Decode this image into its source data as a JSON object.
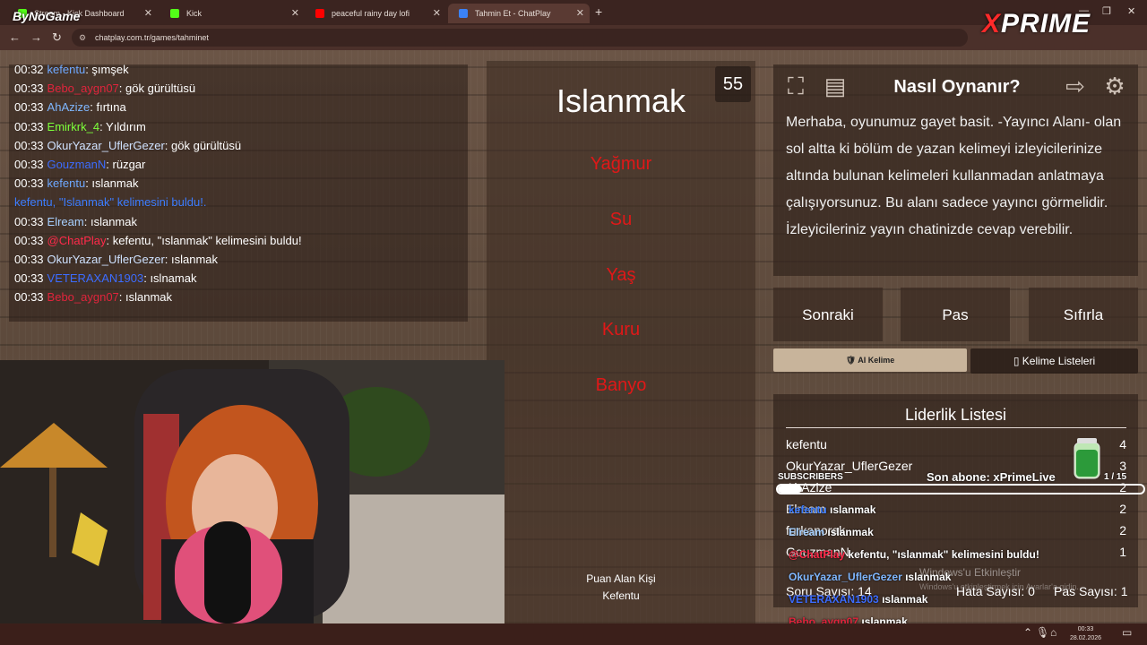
{
  "browser": {
    "tabs": [
      {
        "label": "Stream - Kick Dashboard",
        "color": "#53fc18"
      },
      {
        "label": "Kick",
        "color": "#53fc18"
      },
      {
        "label": "peaceful rainy day lofi",
        "color": "#ff0000"
      },
      {
        "label": "Tahmin Et - ChatPlay",
        "color": "#3b82f6"
      }
    ],
    "url": "chatplay.com.tr/games/tahminet",
    "brand_overlay": "ByNoGame",
    "xprime_x": "X",
    "xprime_rest": "PRIME"
  },
  "chat": [
    {
      "time": "00:32",
      "user": "kefentu",
      "user_color": "#6ea8ff",
      "msg": ": şımşek"
    },
    {
      "time": "00:33",
      "user": "Bebo_aygn07",
      "user_color": "#e0243c",
      "msg": ": gök gürültüsü"
    },
    {
      "time": "00:33",
      "user": "AhAzize",
      "user_color": "#7fb7ff",
      "msg": ": fırtına"
    },
    {
      "time": "00:33",
      "user": "Emirkrk_4",
      "user_color": "#7cff3a",
      "msg": ": Yıldırım"
    },
    {
      "time": "00:33",
      "user": "OkurYazar_UflerGezer",
      "user_color": "#cfe2ff",
      "msg": ": gök gürültüsü"
    },
    {
      "time": "00:33",
      "user": "GouzmanN",
      "user_color": "#3c6cff",
      "msg": ": rüzgar"
    },
    {
      "time": "00:33",
      "user": "kefentu",
      "user_color": "#6ea8ff",
      "msg": ": ıslanmak"
    },
    {
      "time": "",
      "user": "",
      "user_color": "#3c7cff",
      "msg": "kefentu, \"Islanmak\" kelimesini buldu!."
    },
    {
      "time": "00:33",
      "user": "Elream",
      "user_color": "#a7d0ff",
      "msg": ": ıslanmak"
    },
    {
      "time": "00:33",
      "user": "@ChatPlay",
      "user_color": "#ff2a4a",
      "msg": ": kefentu, \"ıslanmak\" kelimesini buldu!"
    },
    {
      "time": "00:33",
      "user": "OkurYazar_UflerGezer",
      "user_color": "#cfe2ff",
      "msg": ": ıslanmak"
    },
    {
      "time": "00:33",
      "user": "VETERAXAN1903",
      "user_color": "#3c6cff",
      "msg": ": ıslnamak"
    },
    {
      "time": "00:33",
      "user": "Bebo_aygn07",
      "user_color": "#e0243c",
      "msg": ": ıslanmak"
    }
  ],
  "game": {
    "word": "Islanmak",
    "timer": "55",
    "taboo": [
      "Yağmur",
      "Su",
      "Yaş",
      "Kuru",
      "Banyo"
    ],
    "scorer_label": "Puan Alan Kişi",
    "scorer_name": "Kefentu"
  },
  "howto": {
    "title": "Nasıl Oynanır?",
    "body": "Merhaba, oyunumuz gayet basit. -Yayıncı Alanı- olan sol altta ki bölüm de yazan kelimeyi izleyicilerinize altında bulunan kelimeleri kullanmadan anlatmaya çalışıyorsunuz. Bu alanı sadece yayıncı görmelidir. İzleyicileriniz yayın chatinizde cevap verebilir."
  },
  "actions": {
    "next": "Sonraki",
    "pass": "Pas",
    "reset": "Sıfırla",
    "ai": "AI Kelime",
    "lists": "Kelime Listeleri"
  },
  "leaderboard": {
    "title": "Liderlik Listesi",
    "rows": [
      {
        "name": "kefentu",
        "score": "4"
      },
      {
        "name": "OkurYazar_UflerGezer",
        "score": "3"
      },
      {
        "name": "AhAzize",
        "score": "2"
      },
      {
        "name": "Elream",
        "score": "2"
      },
      {
        "name": "furkanorak",
        "score": "2"
      },
      {
        "name": "GouzmanN",
        "score": "1"
      }
    ],
    "question_count": "Soru Sayısı: 14",
    "error_count": "Hata Sayısı: 0",
    "pass_count": "Pas Sayısı: 1"
  },
  "stream_overlay": {
    "subs_label": "SUBSCRIBERS",
    "last_sub": "Son abone: xPrimeLive",
    "subs_count": "1 / 15",
    "subs_progress": 0.067,
    "chat": [
      {
        "user": "kefentu",
        "color": "#3c7cff",
        "msg": "ıslanmak"
      },
      {
        "user": "Elream",
        "color": "#a7d0ff",
        "msg": "ıslanmak"
      },
      {
        "user": "@ChatPlay",
        "color": "#ff2a4a",
        "msg": "kefentu, \"ıslanmak\" kelimesini buldu!"
      },
      {
        "user": "OkurYazar_UflerGezer",
        "color": "#7fb7ff",
        "msg": "ıslanmak"
      },
      {
        "user": "VETERAXAN1903",
        "color": "#3c6cff",
        "msg": "ıslanmak"
      },
      {
        "user": "Bebo_aygn07",
        "color": "#e0243c",
        "msg": "ıslanmak"
      }
    ]
  },
  "windows_watermark": {
    "line1": "Windows'u Etkinleştir",
    "line2": "Windows'u etkinleştirmek için Ayarlar'a gidin."
  },
  "taskbar": {
    "time": "00:33",
    "date": "28.02.2026"
  }
}
